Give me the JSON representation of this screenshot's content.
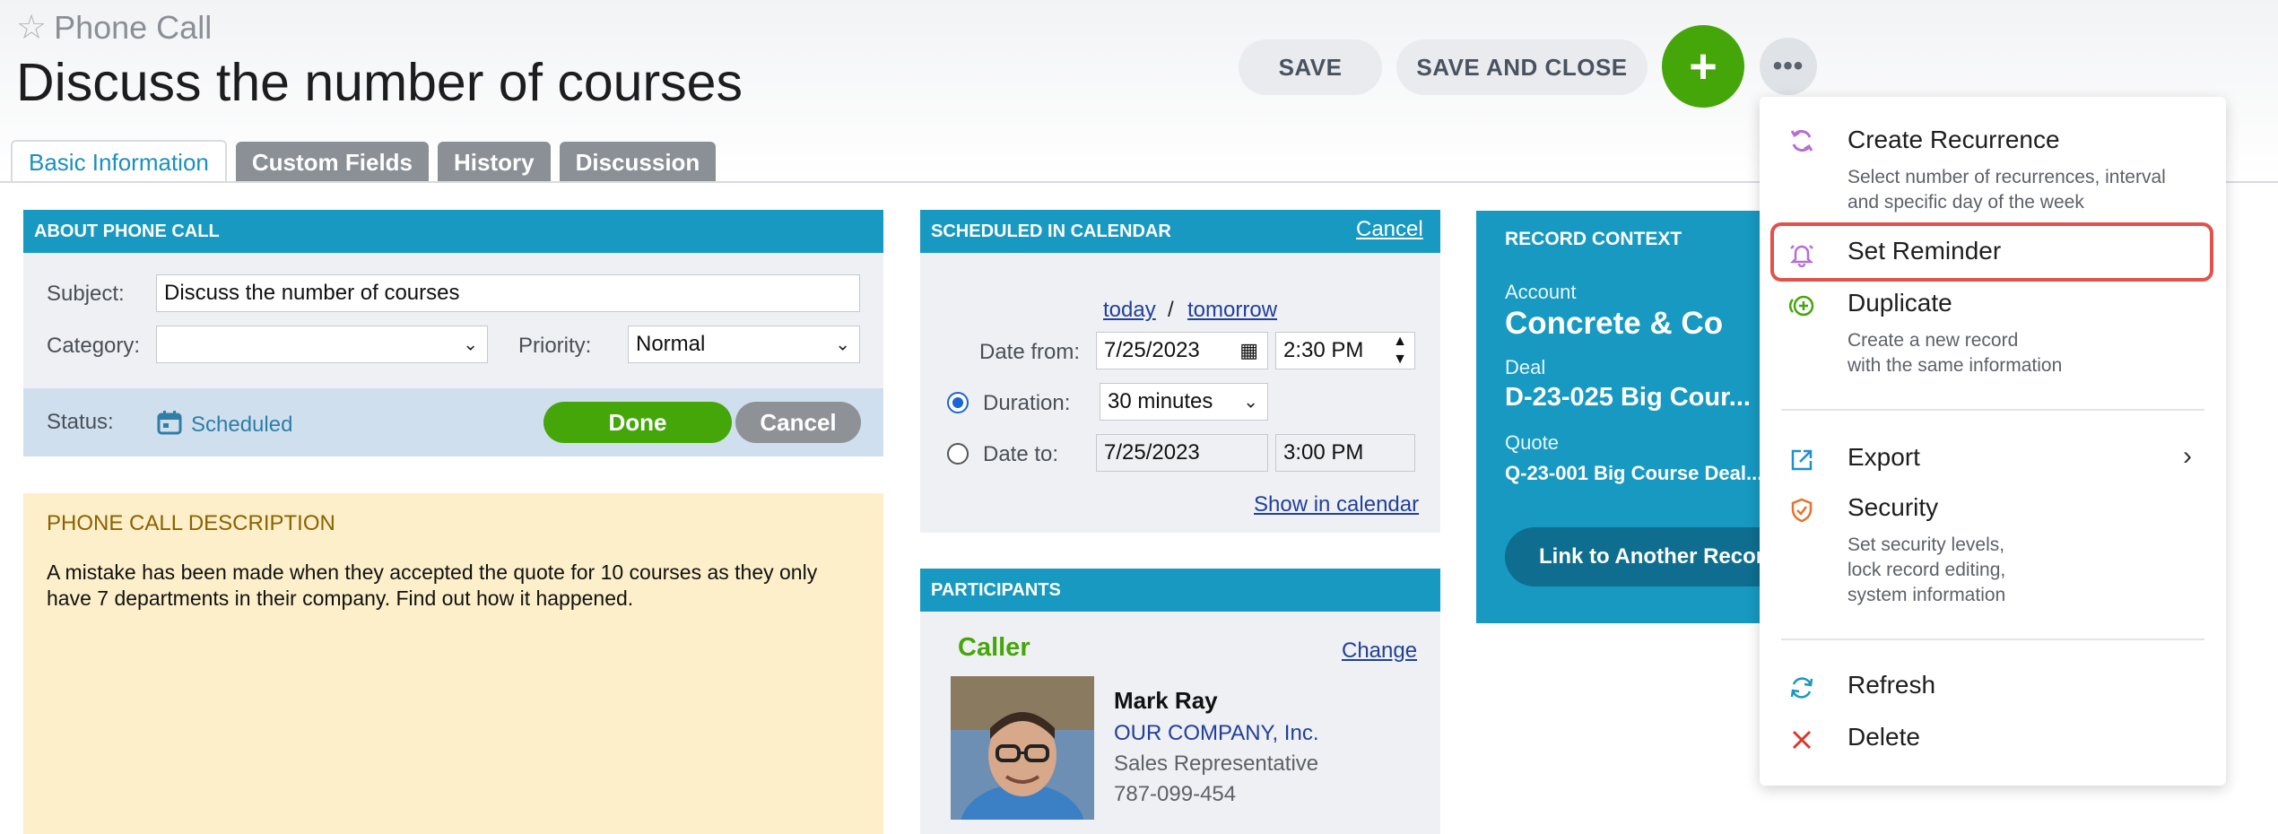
{
  "header": {
    "record_type": "Phone Call",
    "title": "Discuss the number of courses",
    "save_label": "SAVE",
    "save_close_label": "SAVE AND CLOSE",
    "add_label": "+",
    "more_label": "•••"
  },
  "tabs": [
    {
      "label": "Basic Information",
      "active": true
    },
    {
      "label": "Custom Fields",
      "active": false
    },
    {
      "label": "History",
      "active": false
    },
    {
      "label": "Discussion",
      "active": false
    }
  ],
  "about": {
    "heading": "ABOUT PHONE CALL",
    "subject_label": "Subject:",
    "subject_value": "Discuss the number of courses",
    "category_label": "Category:",
    "category_value": "",
    "priority_label": "Priority:",
    "priority_value": "Normal",
    "status_label": "Status:",
    "status_value": "Scheduled",
    "done_label": "Done",
    "cancel_label": "Cancel"
  },
  "description": {
    "heading": "PHONE CALL DESCRIPTION",
    "text": "A mistake has been made when they accepted the quote for 10 courses as they only have 7 departments in their company. Find out how it happened."
  },
  "calendar": {
    "heading": "SCHEDULED IN CALENDAR",
    "cancel_link": "Cancel",
    "today_link": "today",
    "separator": "/",
    "tomorrow_link": "tomorrow",
    "date_from_label": "Date from:",
    "date_from": "7/25/2023",
    "time_from": "2:30 PM",
    "duration_label": "Duration:",
    "duration_value": "30 minutes",
    "date_to_label": "Date to:",
    "date_to": "7/25/2023",
    "time_to": "3:00 PM",
    "show_link": "Show in calendar"
  },
  "participants": {
    "heading": "PARTICIPANTS",
    "role": "Caller",
    "change_link": "Change",
    "name": "Mark Ray",
    "company": "OUR COMPANY, Inc.",
    "position": "Sales Representative",
    "phone": "787-099-454"
  },
  "record_context": {
    "heading": "RECORD CONTEXT",
    "account_label": "Account",
    "account_value": "Concrete & Co",
    "deal_label": "Deal",
    "deal_value": "D-23-025 Big Cour...",
    "quote_label": "Quote",
    "quote_value": "Q-23-001 Big Course Deal...",
    "link_button": "Link to Another Record"
  },
  "menu": {
    "items": [
      {
        "title": "Create Recurrence",
        "sub1": "Select number of recurrences, interval",
        "sub2": "and specific day of the week",
        "icon": "recurrence-icon"
      },
      {
        "title": "Set Reminder",
        "icon": "bell-icon"
      },
      {
        "title": "Duplicate",
        "sub1": "Create a new record",
        "sub2": "with the same information",
        "icon": "duplicate-icon"
      },
      {
        "title": "Export",
        "icon": "export-icon"
      },
      {
        "title": "Security",
        "sub1": "Set security levels,",
        "sub2": "lock record editing,",
        "sub3": "system information",
        "icon": "shield-icon"
      },
      {
        "title": "Refresh",
        "icon": "refresh-icon"
      },
      {
        "title": "Delete",
        "icon": "close-icon"
      }
    ]
  },
  "colors": {
    "accent_blue": "#1799c1",
    "green": "#45a60a",
    "highlight_red": "#e0524a",
    "description_bg": "#fdefc9"
  }
}
